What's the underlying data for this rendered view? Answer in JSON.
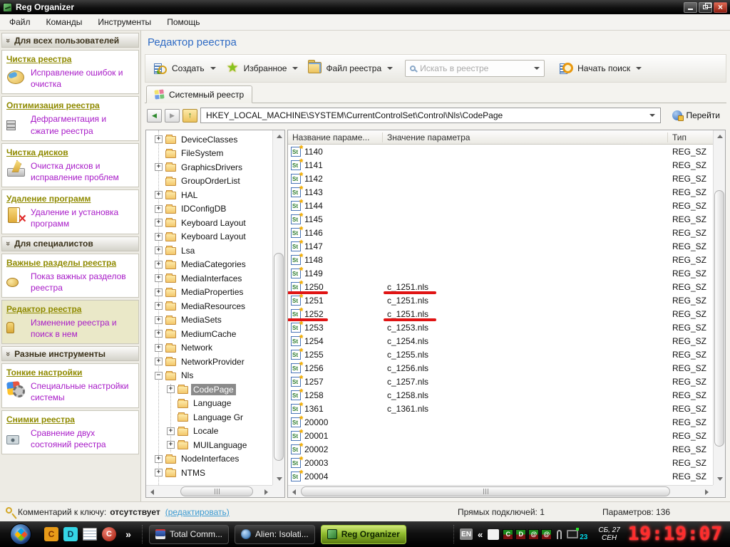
{
  "titlebar": {
    "title": "Reg Organizer"
  },
  "menubar": {
    "items": [
      "Файл",
      "Команды",
      "Инструменты",
      "Помощь"
    ]
  },
  "sidebar": {
    "sections": [
      {
        "header": "Для всех пользователей",
        "items": [
          {
            "title": "Чистка реестра",
            "desc": "Исправление ошибок и очистка",
            "icon": "brush"
          },
          {
            "title": "Оптимизация реестра",
            "desc": "Дефрагментация и сжатие реестра",
            "icon": "defrag"
          },
          {
            "title": "Чистка дисков",
            "desc": "Очистка дисков и исправление проблем",
            "icon": "broom"
          },
          {
            "title": "Удаление программ",
            "desc": "Удаление и установка программ",
            "icon": "uninstall"
          }
        ]
      },
      {
        "header": "Для специалистов",
        "items": [
          {
            "title": "Важные разделы реестра",
            "desc": "Показ важных разделов реестра",
            "icon": "sections"
          },
          {
            "title": "Редактор реестра",
            "desc": "Изменение реестра и поиск в нем",
            "icon": "editor",
            "selected": true
          }
        ]
      },
      {
        "header": "Разные инструменты",
        "items": [
          {
            "title": "Тонкие настройки",
            "desc": "Специальные настройки системы",
            "icon": "tweaks"
          },
          {
            "title": "Снимки реестра",
            "desc": "Сравнение двух состояний реестра",
            "icon": "snapshot"
          }
        ]
      }
    ]
  },
  "main": {
    "page_title": "Редактор реестра",
    "toolbar": {
      "create": "Создать",
      "favorites": "Избранное",
      "regfile": "Файл реестра",
      "search_placeholder": "Искать в реестре",
      "start_search": "Начать поиск"
    },
    "tab": "Системный реестр",
    "address": {
      "path": "HKEY_LOCAL_MACHINE\\SYSTEM\\CurrentControlSet\\Control\\Nls\\CodePage",
      "go": "Перейти"
    }
  },
  "tree": {
    "items": [
      {
        "label": "DeviceClasses",
        "expand": "+",
        "level": 0
      },
      {
        "label": "FileSystem",
        "expand": "",
        "level": 0
      },
      {
        "label": "GraphicsDrivers",
        "expand": "+",
        "level": 0
      },
      {
        "label": "GroupOrderList",
        "expand": "",
        "level": 0
      },
      {
        "label": "HAL",
        "expand": "+",
        "level": 0
      },
      {
        "label": "IDConfigDB",
        "expand": "+",
        "level": 0
      },
      {
        "label": "Keyboard Layout",
        "expand": "+",
        "level": 0
      },
      {
        "label": "Keyboard Layout",
        "expand": "+",
        "level": 0
      },
      {
        "label": "Lsa",
        "expand": "+",
        "level": 0
      },
      {
        "label": "MediaCategories",
        "expand": "+",
        "level": 0
      },
      {
        "label": "MediaInterfaces",
        "expand": "+",
        "level": 0
      },
      {
        "label": "MediaProperties",
        "expand": "+",
        "level": 0
      },
      {
        "label": "MediaResources",
        "expand": "+",
        "level": 0
      },
      {
        "label": "MediaSets",
        "expand": "+",
        "level": 0
      },
      {
        "label": "MediumCache",
        "expand": "+",
        "level": 0
      },
      {
        "label": "Network",
        "expand": "+",
        "level": 0
      },
      {
        "label": "NetworkProvider",
        "expand": "+",
        "level": 0
      },
      {
        "label": "Nls",
        "expand": "−",
        "level": 0
      },
      {
        "label": "CodePage",
        "expand": "+",
        "level": 1,
        "selected": true
      },
      {
        "label": "Language",
        "expand": "",
        "level": 1
      },
      {
        "label": "Language Gr",
        "expand": "",
        "level": 1
      },
      {
        "label": "Locale",
        "expand": "+",
        "level": 1
      },
      {
        "label": "MUILanguage",
        "expand": "+",
        "level": 1
      },
      {
        "label": "NodeInterfaces",
        "expand": "+",
        "level": 0
      },
      {
        "label": "NTMS",
        "expand": "+",
        "level": 0
      }
    ]
  },
  "table": {
    "columns": {
      "name": "Название параме...",
      "value": "Значение параметра",
      "type": "Тип"
    },
    "rows": [
      {
        "name": "1140",
        "value": "",
        "type": "REG_SZ"
      },
      {
        "name": "1141",
        "value": "",
        "type": "REG_SZ"
      },
      {
        "name": "1142",
        "value": "",
        "type": "REG_SZ"
      },
      {
        "name": "1143",
        "value": "",
        "type": "REG_SZ"
      },
      {
        "name": "1144",
        "value": "",
        "type": "REG_SZ"
      },
      {
        "name": "1145",
        "value": "",
        "type": "REG_SZ"
      },
      {
        "name": "1146",
        "value": "",
        "type": "REG_SZ"
      },
      {
        "name": "1147",
        "value": "",
        "type": "REG_SZ"
      },
      {
        "name": "1148",
        "value": "",
        "type": "REG_SZ"
      },
      {
        "name": "1149",
        "value": "",
        "type": "REG_SZ"
      },
      {
        "name": "1250",
        "value": "c_1251.nls",
        "type": "REG_SZ",
        "marked": true
      },
      {
        "name": "1251",
        "value": "c_1251.nls",
        "type": "REG_SZ"
      },
      {
        "name": "1252",
        "value": "c_1251.nls",
        "type": "REG_SZ",
        "marked": true
      },
      {
        "name": "1253",
        "value": "c_1253.nls",
        "type": "REG_SZ"
      },
      {
        "name": "1254",
        "value": "c_1254.nls",
        "type": "REG_SZ"
      },
      {
        "name": "1255",
        "value": "c_1255.nls",
        "type": "REG_SZ"
      },
      {
        "name": "1256",
        "value": "c_1256.nls",
        "type": "REG_SZ"
      },
      {
        "name": "1257",
        "value": "c_1257.nls",
        "type": "REG_SZ"
      },
      {
        "name": "1258",
        "value": "c_1258.nls",
        "type": "REG_SZ"
      },
      {
        "name": "1361",
        "value": "c_1361.nls",
        "type": "REG_SZ"
      },
      {
        "name": "20000",
        "value": "",
        "type": "REG_SZ"
      },
      {
        "name": "20001",
        "value": "",
        "type": "REG_SZ"
      },
      {
        "name": "20002",
        "value": "",
        "type": "REG_SZ"
      },
      {
        "name": "20003",
        "value": "",
        "type": "REG_SZ"
      },
      {
        "name": "20004",
        "value": "",
        "type": "REG_SZ"
      }
    ],
    "annotation_color": "#e01414"
  },
  "statusbar": {
    "comment_label": "Комментарий к ключу:",
    "comment_value": "отсутствует",
    "edit_link": "(редактировать)",
    "subkeys": "Прямых подключей: 1",
    "params": "Параметров: 136"
  },
  "taskbar": {
    "quicklaunch": [
      {
        "kind": "c",
        "glyph": "C"
      },
      {
        "kind": "d",
        "glyph": "D"
      },
      {
        "kind": "notepad",
        "glyph": ""
      },
      {
        "kind": "ccleaner",
        "glyph": "C"
      },
      {
        "kind": "chevron",
        "glyph": "»"
      }
    ],
    "tasks": [
      {
        "label": "Total Comm...",
        "icon": "totalcmd"
      },
      {
        "label": "Alien: Isolati...",
        "icon": "globe"
      },
      {
        "label": "Reg Organizer",
        "icon": "regorg",
        "active": true
      }
    ],
    "tray": {
      "lang": "EN",
      "collapse": "«",
      "boxes": [
        {
          "g": "C"
        },
        {
          "g": "D"
        },
        {
          "g": "@"
        },
        {
          "g": "@"
        }
      ],
      "monitor_count": "23",
      "date_line1": "СБ, 27",
      "date_line2": "СЕН",
      "clock": "19:19:07"
    },
    "active_color": "#90bc2e"
  }
}
